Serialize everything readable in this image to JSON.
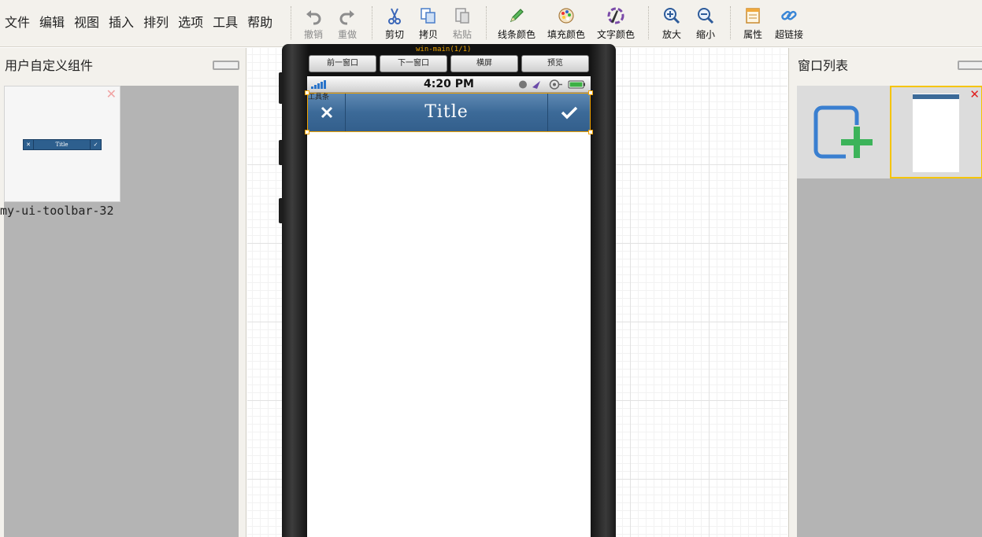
{
  "menu": [
    "文件",
    "编辑",
    "视图",
    "插入",
    "排列",
    "选项",
    "工具",
    "帮助"
  ],
  "tools": {
    "undo": "撤销",
    "redo": "重做",
    "cut": "剪切",
    "copy": "拷贝",
    "paste": "粘贴",
    "line_color": "线条颜色",
    "fill_color": "填充颜色",
    "text_color": "文字颜色",
    "zoom_in": "放大",
    "zoom_out": "缩小",
    "properties": "属性",
    "hyperlink": "超链接"
  },
  "left_panel": {
    "title": "用户自定义组件",
    "component_name": "my-ui-toolbar-32",
    "thumb_title": "Title"
  },
  "canvas": {
    "window_name": "win-main(1/1)",
    "nav_buttons": [
      "前一窗口",
      "下一窗口",
      "横屏",
      "预览"
    ],
    "status_time": "4:20 PM",
    "toolbar_label": "工具条",
    "toolbar_title": "Title"
  },
  "right_panel": {
    "title": "窗口列表"
  },
  "colors": {
    "toolbar_blue": "#3c6a98",
    "selection": "#f2a200",
    "add_icon_blue": "#3a7fd0",
    "add_icon_green": "#3cb35a"
  }
}
